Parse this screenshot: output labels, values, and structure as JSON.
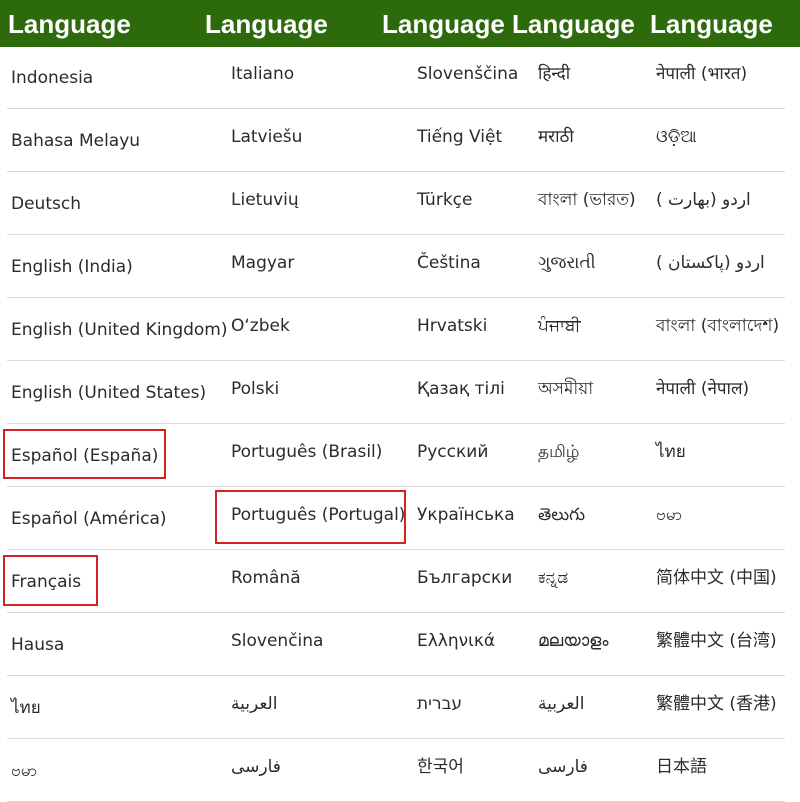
{
  "header": {
    "columns": [
      "Language",
      "Language",
      "Language",
      "Language",
      "Language"
    ]
  },
  "colors": {
    "header_bg": "#2c6a0c",
    "header_text": "#ffffff",
    "highlight_border": "#d32222"
  },
  "rows": [
    [
      "Indonesia",
      "Italiano",
      "Slovenščina",
      "हिन्दी",
      "नेपाली (भारत)"
    ],
    [
      "Bahasa Melayu",
      "Latviešu",
      "Tiếng Việt",
      "मराठी",
      "ଓଡ଼ିଆ"
    ],
    [
      "Deutsch",
      "Lietuvių",
      "Türkçe",
      "বাংলা (ভারত)",
      "اردو (بھارت )"
    ],
    [
      "English (India)",
      "Magyar",
      "Čeština",
      "ગુજરાતી",
      "اردو (پاکستان )"
    ],
    [
      "English (United Kingdom)",
      "O‘zbek",
      "Hrvatski",
      "ਪੰਜਾਬੀ",
      "বাংলা (বাংলাদেশ)"
    ],
    [
      "English (United States)",
      "Polski",
      "Қазақ тілі",
      "অসমীয়া",
      "नेपाली (नेपाल)"
    ],
    [
      "Español (España)",
      "Português (Brasil)",
      "Русский",
      "தமிழ்",
      "ไทย"
    ],
    [
      "Español (América)",
      "Português (Portugal)",
      "Українська",
      "తెలుగు",
      "ဗမာ"
    ],
    [
      "Français",
      "Română",
      "Български",
      "ಕನ್ನಡ",
      "简体中文 (中国)"
    ],
    [
      "Hausa",
      "Slovenčina",
      "Ελληνικά",
      "മലയാളം",
      "繁體中文 (台湾)"
    ],
    [
      "ไทย",
      "العربية",
      "עברית",
      "العربية",
      "繁體中文 (香港)"
    ],
    [
      "ဗမာ",
      "فارسی",
      "한국어",
      "فارسی",
      "日本語"
    ]
  ]
}
